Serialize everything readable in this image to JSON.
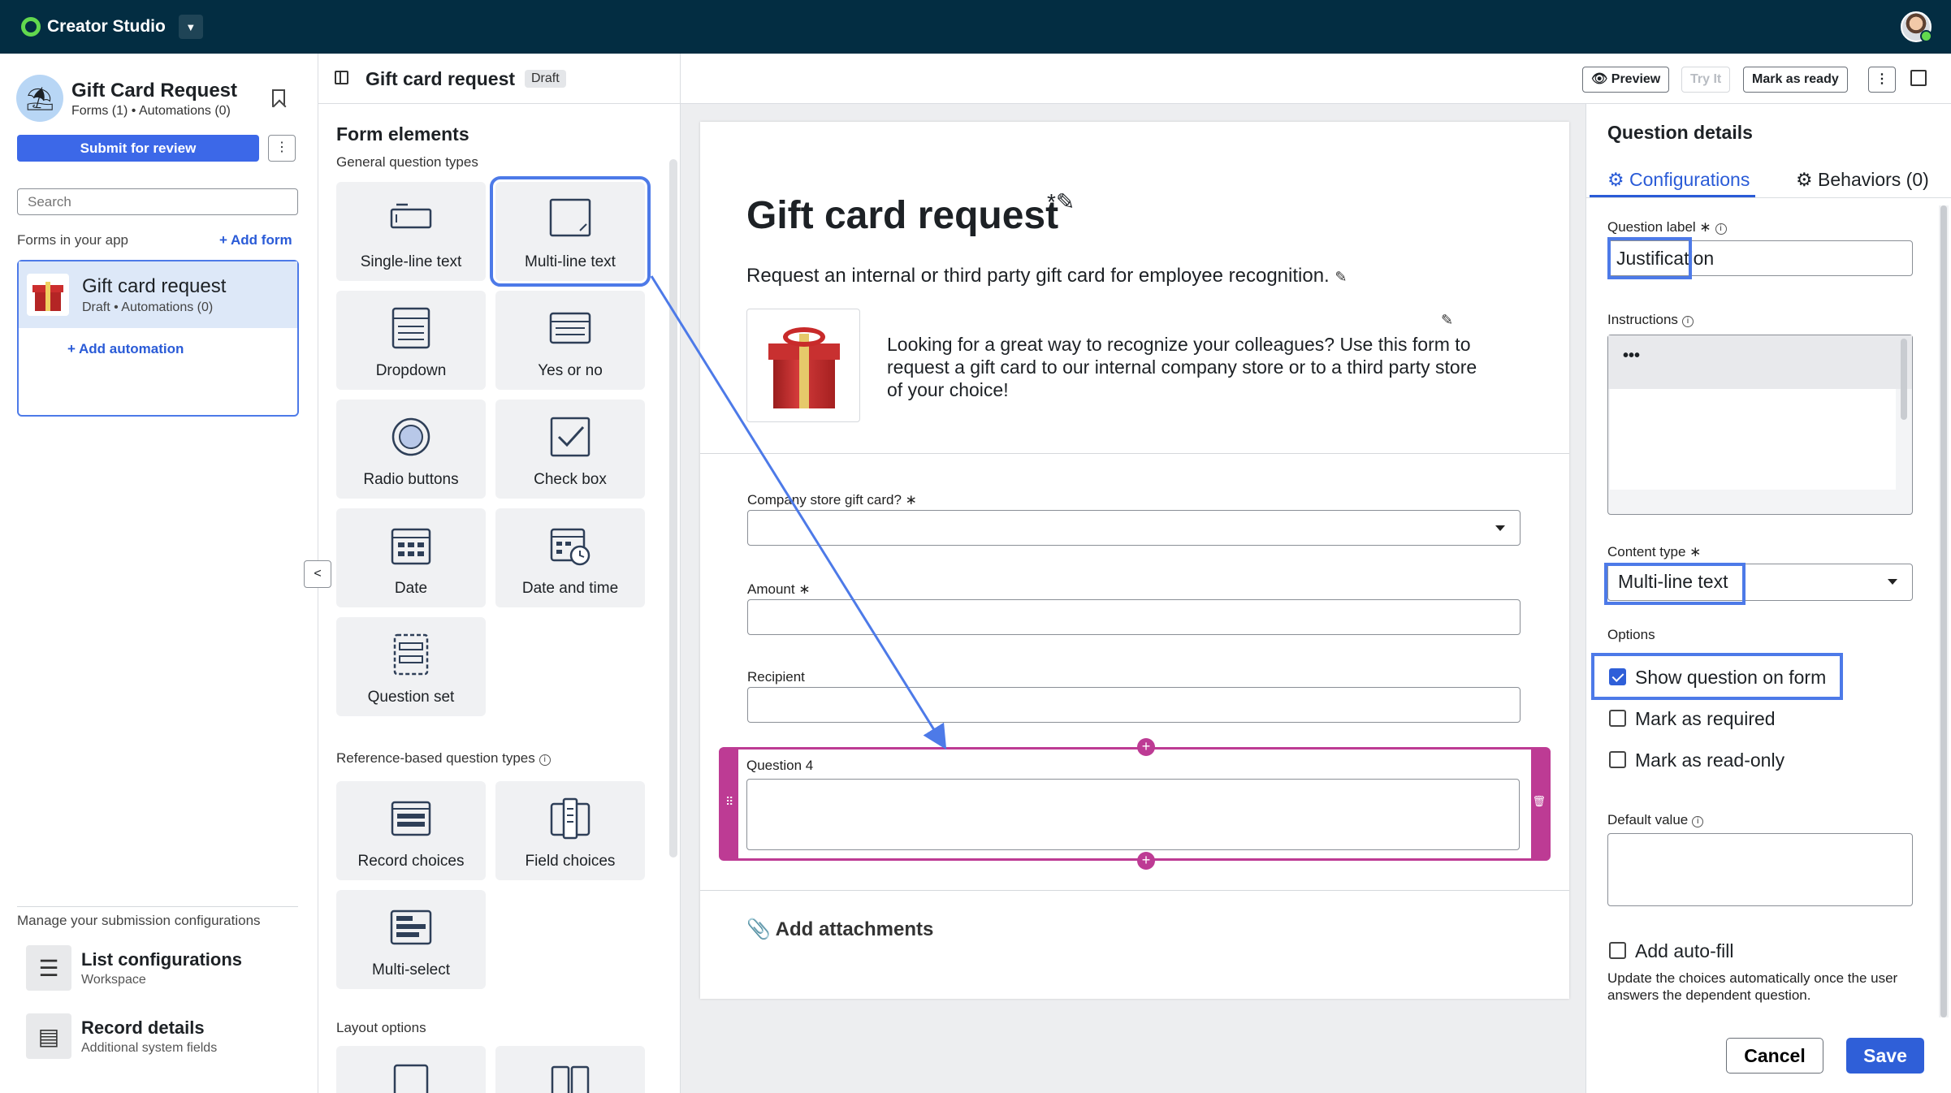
{
  "topbar": {
    "brand": "Creator Studio",
    "dropdown_icon": "chevron-down-icon"
  },
  "sidebar": {
    "app_title": "Gift Card Request",
    "app_subtitle": "Forms (1) • Automations (0)",
    "submit_label": "Submit for review",
    "more_label": "⋮",
    "search_placeholder": "Search",
    "forms_label": "Forms in your app",
    "add_form_label": "+ Add form",
    "form_card": {
      "title": "Gift card request",
      "subtitle": "Draft • Automations (0)",
      "add_automation": "+ Add automation"
    },
    "manage_label": "Manage your submission configurations",
    "configs": [
      {
        "title": "List configurations",
        "subtitle": "Workspace"
      },
      {
        "title": "Record details",
        "subtitle": "Additional system fields"
      }
    ]
  },
  "header": {
    "form_title": "Gift card request",
    "badge": "Draft",
    "preview_label": "Preview",
    "tryit_label": "Try It",
    "mark_ready_label": "Mark as ready",
    "more_label": "⋮"
  },
  "elements": {
    "title": "Form elements",
    "general_label": "General question types",
    "general": [
      "Single-line text",
      "Multi-line text",
      "Dropdown",
      "Yes or no",
      "Radio buttons",
      "Check box",
      "Date",
      "Date and time",
      "Question set"
    ],
    "reference_label": "Reference-based question types",
    "reference": [
      "Record choices",
      "Field choices",
      "Multi-select"
    ],
    "layout_label": "Layout options"
  },
  "canvas": {
    "title": "Gift card request",
    "title_mark": "*",
    "description": "Request an internal or third party gift card for employee recognition.",
    "paragraph": "Looking for a great way to recognize your colleagues? Use this form to request a gift card to our internal company store or to a third party store of your choice!",
    "fields": [
      {
        "label": "Company store gift card?",
        "required_mark": "∗"
      },
      {
        "label": "Amount",
        "required_mark": "∗"
      },
      {
        "label": "Recipient",
        "required_mark": ""
      }
    ],
    "question4_label": "Question 4",
    "add_attachments": "Add attachments"
  },
  "details": {
    "title": "Question details",
    "tab_config": "Configurations",
    "tab_behaviors": "Behaviors (0)",
    "label_label": "Question label",
    "label_value": "Justification",
    "instructions_label": "Instructions",
    "instructions_toolbar": "•••",
    "content_type_label": "Content type",
    "content_type_value": "Multi-line text",
    "options_label": "Options",
    "opt_show": "Show question on form",
    "opt_required": "Mark as required",
    "opt_readonly": "Mark as read-only",
    "default_label": "Default value",
    "autofill_label": "Add auto-fill",
    "autofill_help": "Update the choices automatically once the user answers the dependent question.",
    "cancel_label": "Cancel",
    "save_label": "Save",
    "show_checked": true,
    "required_checked": false,
    "readonly_checked": false,
    "autofill_checked": false
  },
  "colors": {
    "accent": "#2f5fd8",
    "topbar": "#032d42",
    "question_highlight": "#bd3b94",
    "annotation": "#4d7ae8"
  }
}
